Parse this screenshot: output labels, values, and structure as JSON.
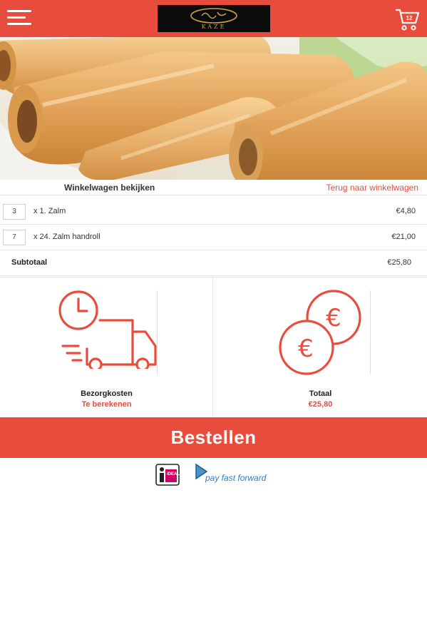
{
  "header": {
    "menu_icon": "hamburger-menu-icon",
    "logo_text": "KAZE",
    "cart_icon": "shopping-cart-icon",
    "cart_count": "12"
  },
  "hero": {
    "image": "spring-rolls-photo"
  },
  "cart": {
    "header_left": "Winkelwagen bekijken",
    "header_right": "Terug naar winkelwagen",
    "items": [
      {
        "qty": "3",
        "name": "x 1. Zalm",
        "price": "€4,80"
      },
      {
        "qty": "7",
        "name": "x 24. Zalm handroll",
        "price": "€21,00"
      }
    ],
    "subtotal_label": "Subtotaal",
    "subtotal_value": "€25,80"
  },
  "summary": {
    "delivery": {
      "icon": "delivery-truck-clock-icon",
      "title": "Bezorgkosten",
      "value": "Te berekenen"
    },
    "total": {
      "icon": "euro-coins-icon",
      "title": "Totaal",
      "value": "€25,80"
    }
  },
  "order_button": "Bestellen",
  "payment": {
    "ideal_icon": "ideal-logo",
    "ideal_text": "iDEAL",
    "payff_icon": "pay-fast-forward-logo",
    "payff_text": "pay fast forward"
  },
  "colors": {
    "accent": "#e84c3d",
    "logo_bg": "#0b0b0b",
    "payff_blue": "#2b7fbf",
    "ideal_pink": "#cc0066"
  }
}
